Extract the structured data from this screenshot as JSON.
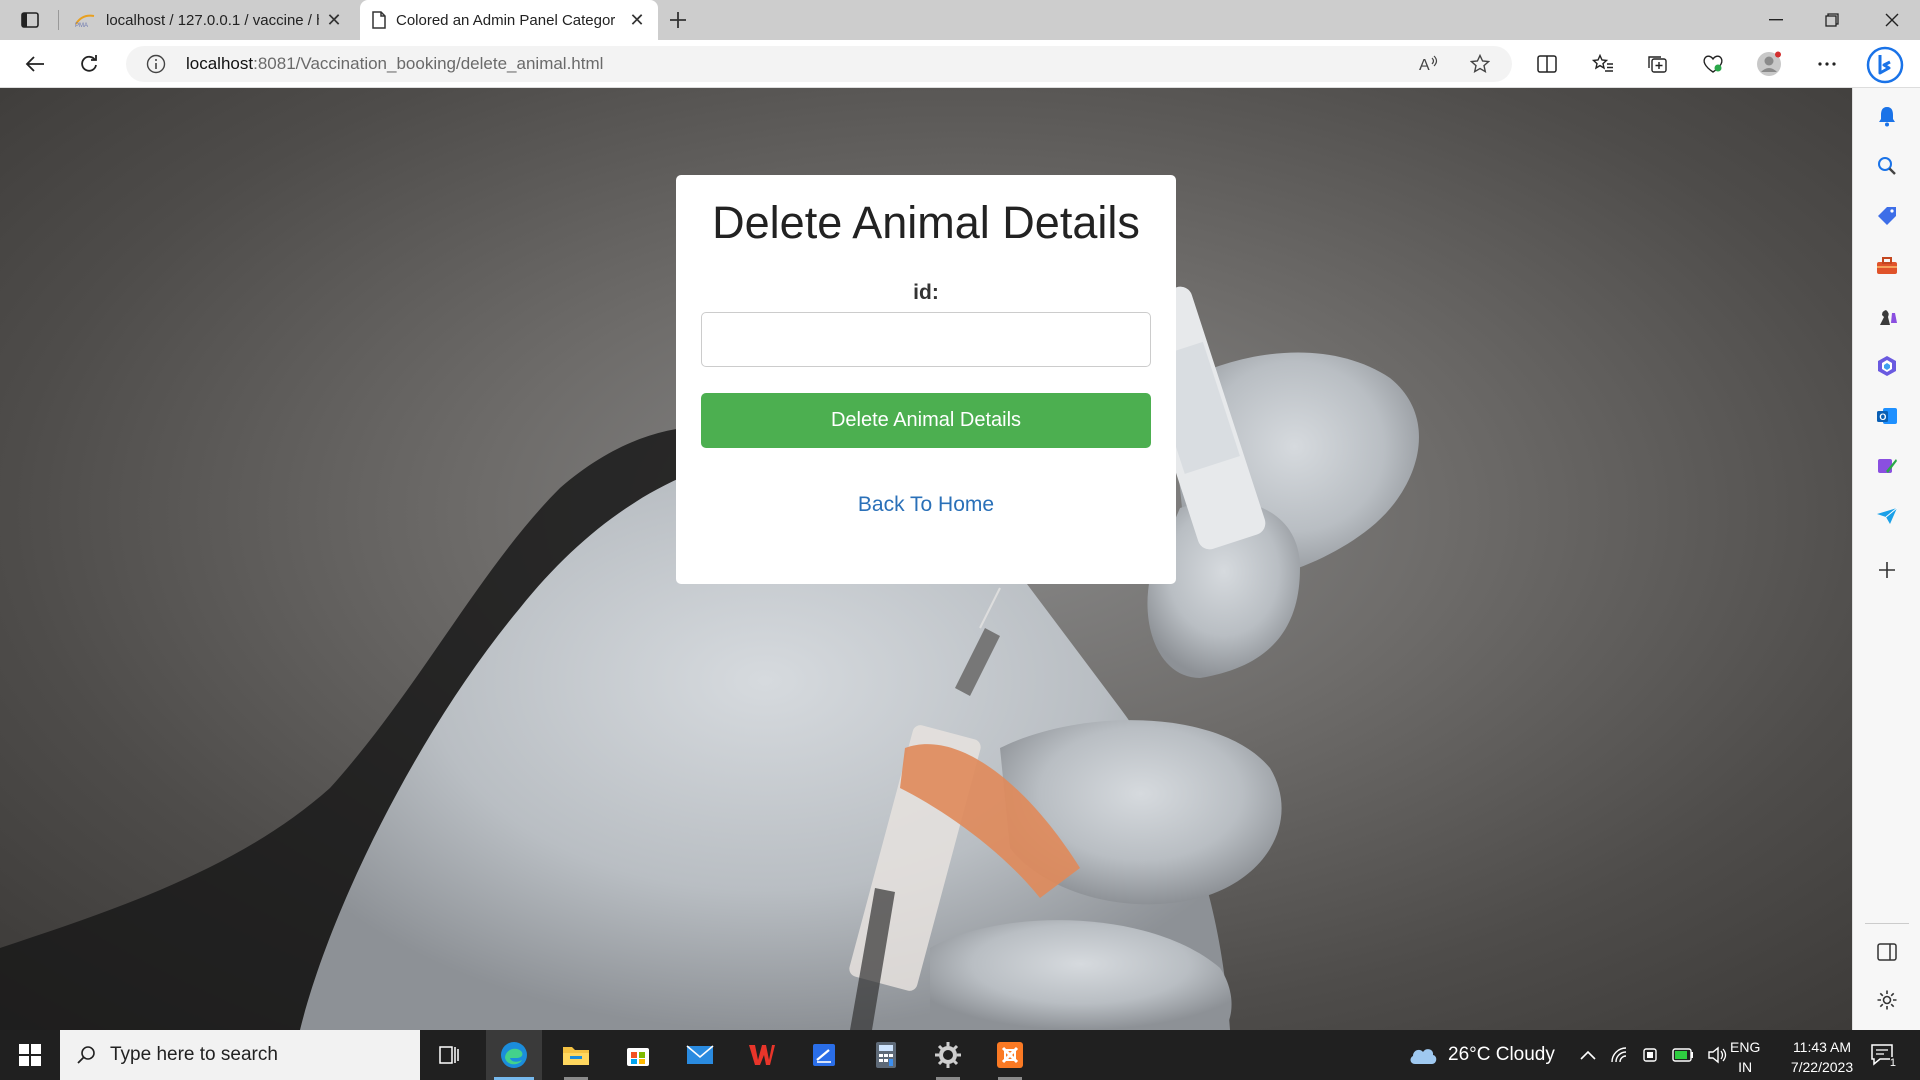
{
  "browser": {
    "tabs": [
      {
        "title": "localhost / 127.0.0.1 / vaccine / h",
        "favicon": "phpmyadmin-icon"
      },
      {
        "title": "Colored an Admin Panel Categor",
        "favicon": "page-icon",
        "active": true
      }
    ],
    "url_host": "localhost",
    "url_rest": ":8081/Vaccination_booking/delete_animal.html"
  },
  "form": {
    "heading": "Delete Animal Details",
    "id_label": "id:",
    "id_value": "",
    "submit_label": "Delete Animal Details",
    "back_link": "Back To Home",
    "button_color": "#4caf50",
    "link_color": "#2a70b8"
  },
  "taskbar": {
    "search_placeholder": "Type here to search",
    "weather": "26°C  Cloudy",
    "lang_top": "ENG",
    "lang_bottom": "IN",
    "time": "11:43 AM",
    "date": "7/22/2023",
    "notification_count": "1"
  }
}
